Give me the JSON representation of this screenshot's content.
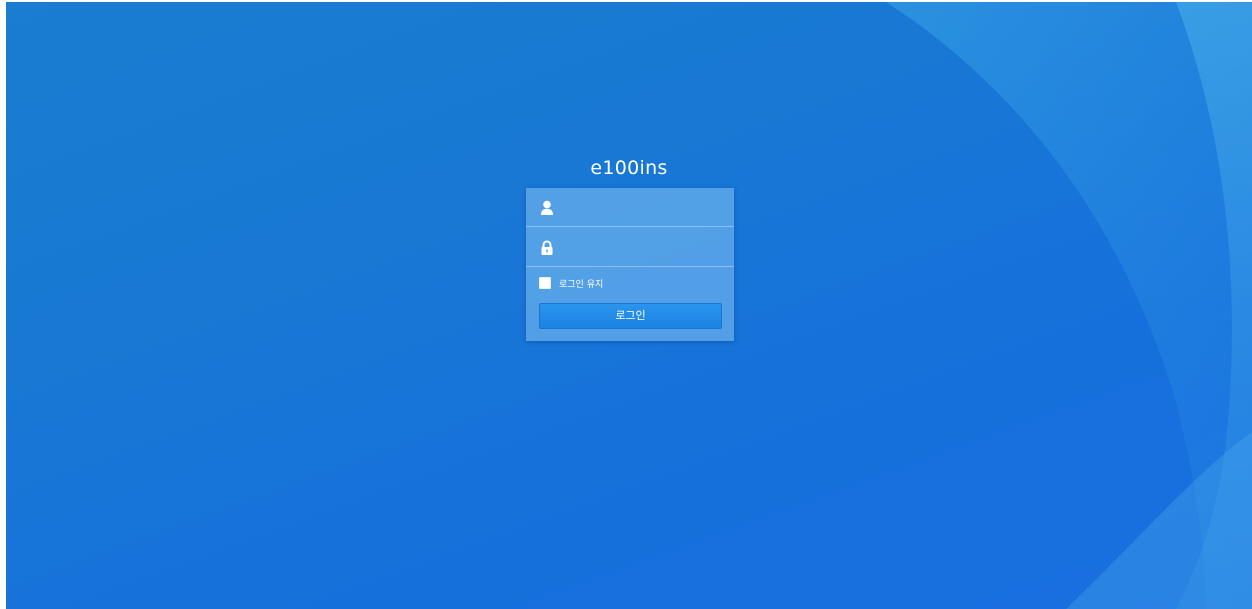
{
  "app": {
    "title": "e100ins"
  },
  "login_form": {
    "username": {
      "icon": "user-icon",
      "value": "",
      "placeholder": ""
    },
    "password": {
      "icon": "lock-icon",
      "value": "",
      "placeholder": ""
    },
    "remember": {
      "label": "로그인 유지",
      "checked": false
    },
    "submit_label": "로그인"
  },
  "colors": {
    "background": "#1878d4",
    "panel": "#78b9f0",
    "button": "#1b82e2",
    "text": "#ffffff"
  }
}
